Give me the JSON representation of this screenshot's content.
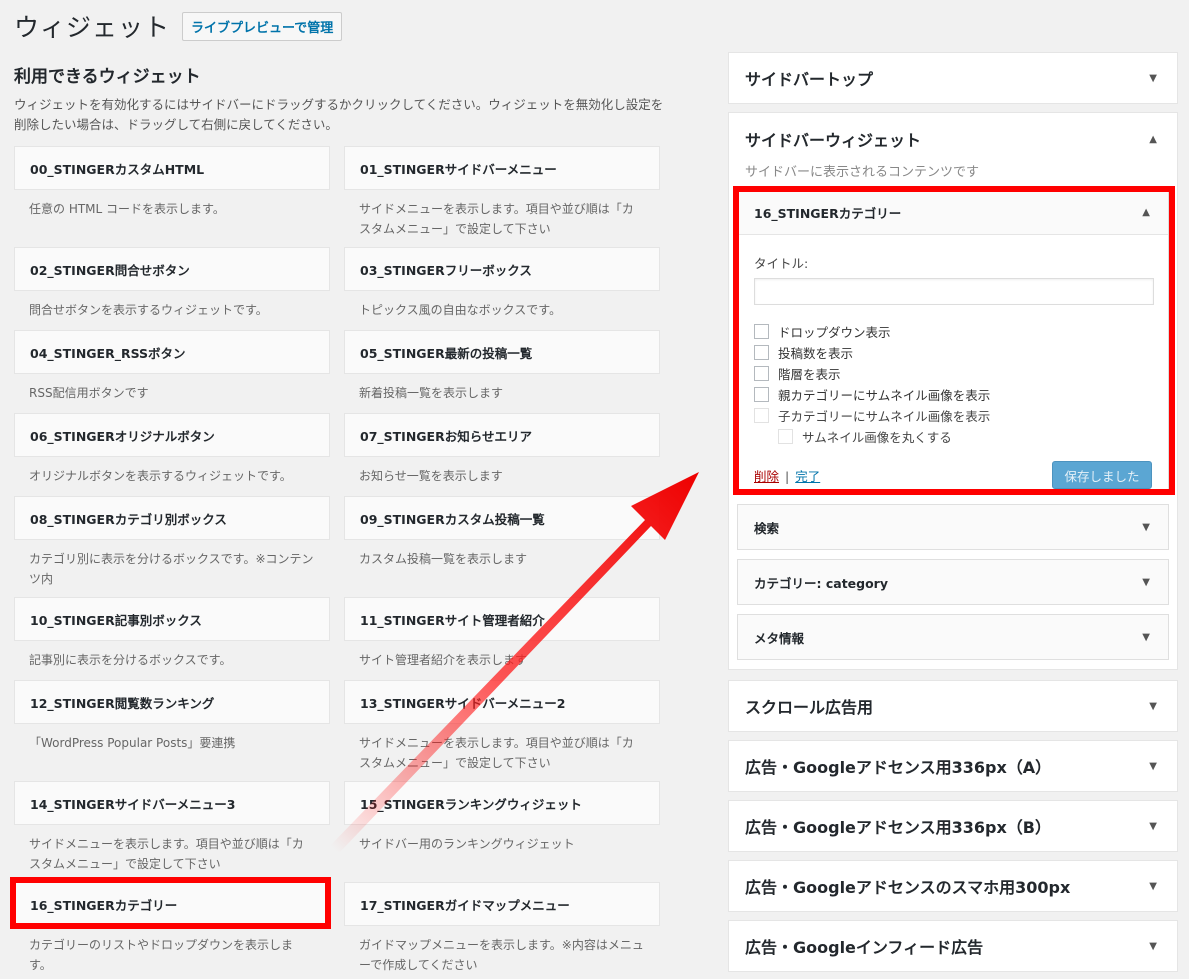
{
  "header": {
    "title": "ウィジェット",
    "preview_button": "ライブプレビューで管理"
  },
  "available": {
    "title": "利用できるウィジェット",
    "description": "ウィジェットを有効化するにはサイドバーにドラッグするかクリックしてください。ウィジェットを無効化し設定を削除したい場合は、ドラッグして右側に戻してください。",
    "widgets": [
      {
        "name": "00_STINGERカスタムHTML",
        "desc": "任意の HTML コードを表示します。"
      },
      {
        "name": "01_STINGERサイドバーメニュー",
        "desc": "サイドメニューを表示します。項目や並び順は「カスタムメニュー」で設定して下さい"
      },
      {
        "name": "02_STINGER問合せボタン",
        "desc": "問合せボタンを表示するウィジェットです。"
      },
      {
        "name": "03_STINGERフリーボックス",
        "desc": "トピックス風の自由なボックスです。"
      },
      {
        "name": "04_STINGER_RSSボタン",
        "desc": "RSS配信用ボタンです"
      },
      {
        "name": "05_STINGER最新の投稿一覧",
        "desc": "新着投稿一覧を表示します"
      },
      {
        "name": "06_STINGERオリジナルボタン",
        "desc": "オリジナルボタンを表示するウィジェットです。"
      },
      {
        "name": "07_STINGERお知らせエリア",
        "desc": "お知らせ一覧を表示します"
      },
      {
        "name": "08_STINGERカテゴリ別ボックス",
        "desc": "カテゴリ別に表示を分けるボックスです。※コンテンツ内"
      },
      {
        "name": "09_STINGERカスタム投稿一覧",
        "desc": "カスタム投稿一覧を表示します"
      },
      {
        "name": "10_STINGER記事別ボックス",
        "desc": "記事別に表示を分けるボックスです。"
      },
      {
        "name": "11_STINGERサイト管理者紹介",
        "desc": "サイト管理者紹介を表示します"
      },
      {
        "name": "12_STINGER閲覧数ランキング",
        "desc": "「WordPress Popular Posts」要連携"
      },
      {
        "name": "13_STINGERサイドバーメニュー2",
        "desc": "サイドメニューを表示します。項目や並び順は「カスタムメニュー」で設定して下さい"
      },
      {
        "name": "14_STINGERサイドバーメニュー3",
        "desc": "サイドメニューを表示します。項目や並び順は「カスタムメニュー」で設定して下さい"
      },
      {
        "name": "15_STINGERランキングウィジェット",
        "desc": "サイドバー用のランキングウィジェット"
      },
      {
        "name": "16_STINGERカテゴリー",
        "desc": "カテゴリーのリストやドロップダウンを表示します。"
      },
      {
        "name": "17_STINGERガイドマップメニュー",
        "desc": "ガイドマップメニューを表示します。※内容はメニューで作成してください"
      }
    ]
  },
  "sidebars": {
    "top": {
      "title": "サイドバートップ"
    },
    "main": {
      "title": "サイドバーウィジェット",
      "description": "サイドバーに表示されるコンテンツです",
      "expanded_widget": {
        "title": "16_STINGERカテゴリー",
        "title_label": "タイトル:",
        "title_value": "",
        "options": [
          "ドロップダウン表示",
          "投稿数を表示",
          "階層を表示",
          "親カテゴリーにサムネイル画像を表示",
          "子カテゴリーにサムネイル画像を表示",
          "サムネイル画像を丸くする"
        ],
        "delete_link": "削除",
        "separator": "|",
        "done_link": "完了",
        "save_button": "保存しました"
      },
      "widgets": [
        "検索",
        "カテゴリー: category",
        "メタ情報"
      ]
    },
    "others": [
      "スクロール広告用",
      "広告・Googleアドセンス用336px（A）",
      "広告・Googleアドセンス用336px（B）",
      "広告・Googleアドセンスのスマホ用300px",
      "広告・Googleインフィード広告"
    ]
  },
  "colors": {
    "highlight": "#ff0000",
    "link": "#0073aa",
    "delete": "#aa0000",
    "save_button": "#5ba6d3"
  },
  "icons": {
    "collapse": "arrow-up-icon",
    "expand": "arrow-down-icon"
  }
}
